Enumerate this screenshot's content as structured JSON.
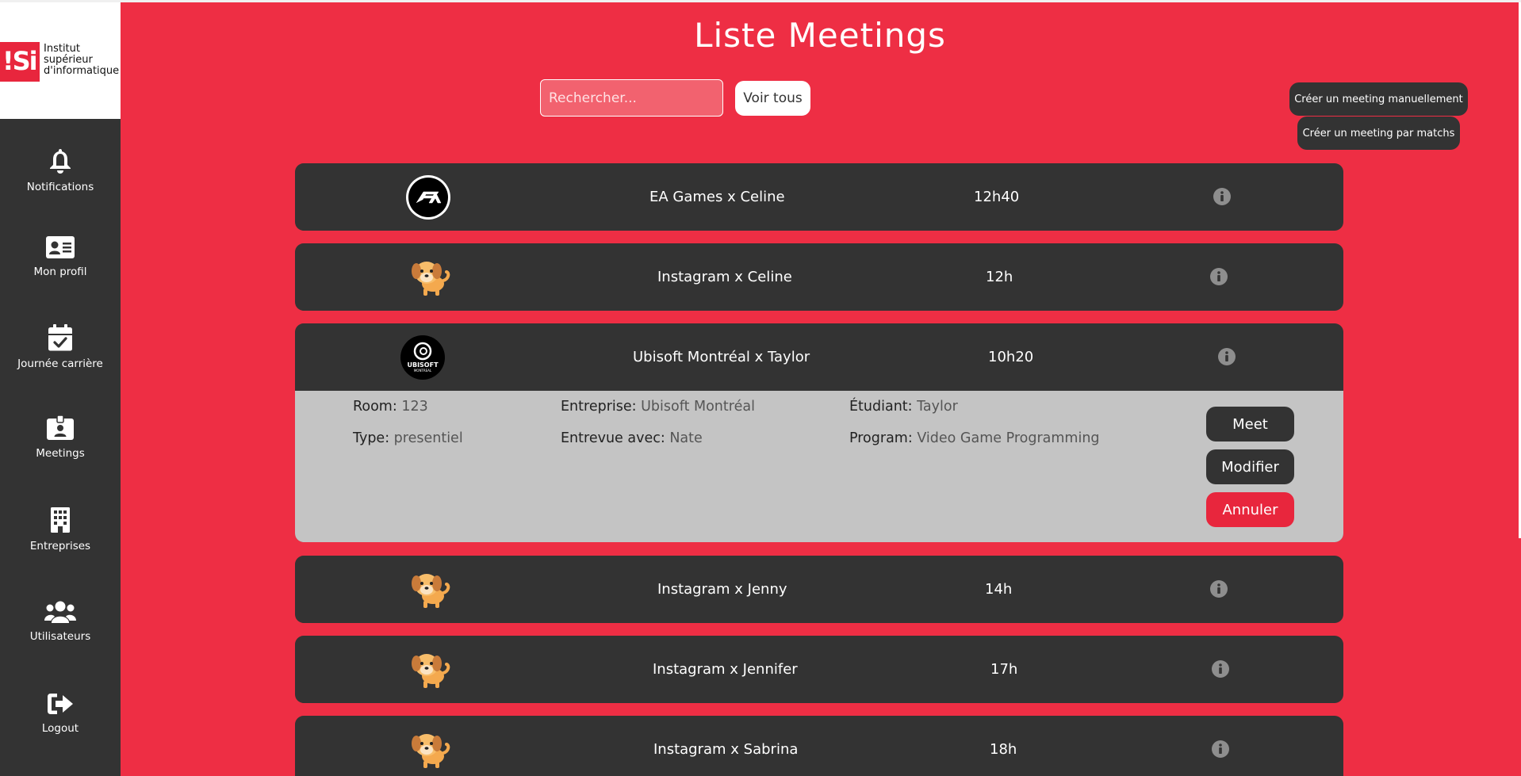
{
  "logo": {
    "mark": "!Si",
    "text": "Institut\nsupérieur\nd'informatique"
  },
  "sidebar": {
    "items": [
      {
        "label": "Notifications",
        "icon": "bell-icon"
      },
      {
        "label": "Mon profil",
        "icon": "id-card-icon"
      },
      {
        "label": "Journée carrière",
        "icon": "calendar-check-icon"
      },
      {
        "label": "Meetings",
        "icon": "badge-icon"
      },
      {
        "label": "Entreprises",
        "icon": "building-icon"
      },
      {
        "label": "Utilisateurs",
        "icon": "users-icon"
      },
      {
        "label": "Logout",
        "icon": "logout-icon"
      }
    ]
  },
  "header": {
    "title": "Liste Meetings",
    "search_placeholder": "Rechercher...",
    "voir_tous_label": "Voir tous",
    "create_manual_label": "Créer un meeting manuellement",
    "create_matches_label": "Créer un meeting par matchs"
  },
  "meetings": [
    {
      "title": "EA Games x Celine",
      "time": "12h40",
      "logo": "ea-logo"
    },
    {
      "title": "Instagram x Celine",
      "time": "12h",
      "logo": "puppy-logo"
    },
    {
      "title": "Ubisoft Montréal x Taylor",
      "time": "10h20",
      "logo": "ubisoft-logo",
      "expanded": true,
      "details": {
        "room_label": "Room:",
        "room": "123",
        "type_label": "Type:",
        "type": "presentiel",
        "entreprise_label": "Entreprise:",
        "entreprise": "Ubisoft Montréal",
        "entrevue_label": "Entrevue avec:",
        "entrevue": "Nate",
        "etudiant_label": "Étudiant:",
        "etudiant": "Taylor",
        "program_label": "Program:",
        "program": "Video Game Programming",
        "meet_label": "Meet",
        "modifier_label": "Modifier",
        "annuler_label": "Annuler"
      }
    },
    {
      "title": "Instagram x Jenny",
      "time": "14h",
      "logo": "puppy-logo"
    },
    {
      "title": "Instagram x Jennifer",
      "time": "17h",
      "logo": "puppy-logo"
    },
    {
      "title": "Instagram x Sabrina",
      "time": "18h",
      "logo": "puppy-logo"
    }
  ],
  "ubisoft_logo_text": {
    "line1": "UBISOFT",
    "line2": "MONTREAL"
  },
  "colors": {
    "background": "#ee2e44",
    "card": "#333333",
    "details": "#c4c4c4",
    "annuler": "#e8263d",
    "info_icon": "#8e8e8e"
  }
}
